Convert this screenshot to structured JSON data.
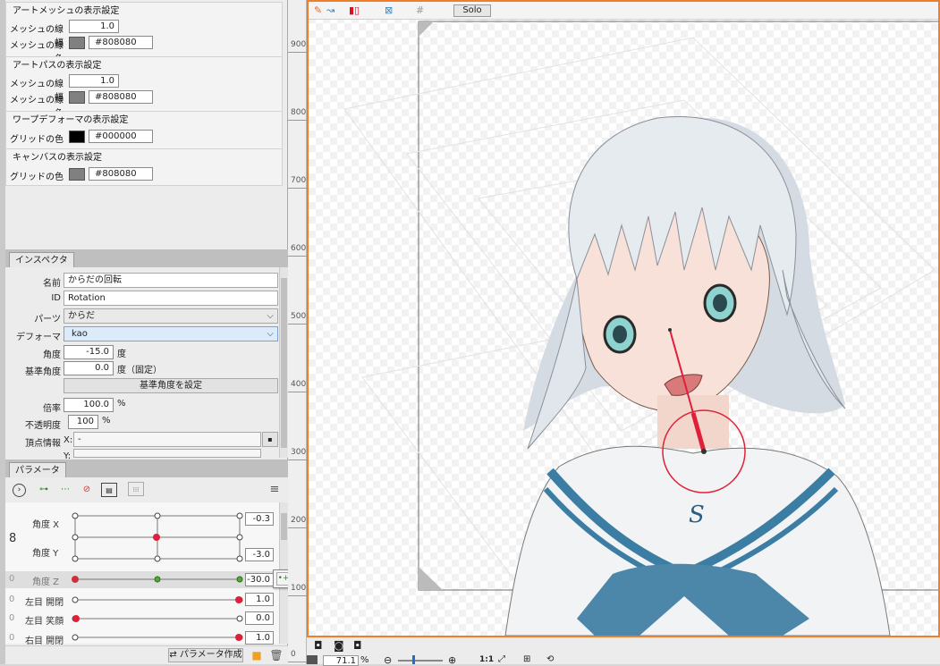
{
  "display_settings": {
    "artmesh_title": "アートメッシュの表示設定",
    "artmesh_line_width_label": "メッシュの線幅",
    "artmesh_line_width_value": "1.0",
    "artmesh_line_color_label": "メッシュの線色",
    "artmesh_line_color": "#808080",
    "artpath_title": "アートパスの表示設定",
    "artpath_line_width_label": "メッシュの線幅",
    "artpath_line_width_value": "1.0",
    "artpath_line_color_label": "メッシュの線色",
    "artpath_line_color": "#808080",
    "warp_title": "ワープデフォーマの表示設定",
    "warp_grid_label": "グリッドの色",
    "warp_grid_color": "#000000",
    "canvas_title": "キャンバスの表示設定",
    "canvas_grid_label": "グリッドの色",
    "canvas_grid_color": "#808080"
  },
  "inspector": {
    "tab": "インスペクタ",
    "name_label": "名前",
    "name_value": "からだの回転",
    "id_label": "ID",
    "id_value": "Rotation",
    "parts_label": "パーツ",
    "parts_value": "からだ",
    "deformer_label": "デフォーマ",
    "deformer_value": "kao",
    "angle_label": "角度",
    "angle_value": "-15.0",
    "angle_unit": "度",
    "base_angle_label": "基準角度",
    "base_angle_value": "0.0",
    "base_angle_unit": "度（固定）",
    "set_base_angle_button": "基準角度を設定",
    "scale_label": "倍率",
    "scale_value": "100.0",
    "scale_unit": "%",
    "opacity_label": "不透明度",
    "opacity_value": "100",
    "opacity_unit": "%",
    "vertex_label": "頂点情報",
    "vertex_x": "X:",
    "vertex_x_value": "-",
    "vertex_y": "Y:"
  },
  "parameters": {
    "tab": "パラメータ",
    "rows": [
      {
        "label": "角度 X",
        "value": "-0.3"
      },
      {
        "label": "角度 Y",
        "value": "-3.0"
      },
      {
        "label": "角度 Z",
        "value": "-30.0"
      },
      {
        "label": "左目 開閉",
        "value": "1.0"
      },
      {
        "label": "左目 笑顔",
        "value": "0.0"
      },
      {
        "label": "右目 開閉",
        "value": "1.0"
      }
    ],
    "create_button": "パラメータ作成",
    "popup_dropdown": "▼"
  },
  "ruler": {
    "ticks": [
      "900",
      "800",
      "700",
      "600",
      "500",
      "400",
      "300",
      "200",
      "100",
      "0"
    ]
  },
  "toolbar": {
    "solo_label": "Solo"
  },
  "statusbar": {
    "zoom_value": "71.1",
    "zoom_unit": "%",
    "ratio_label": "1:1"
  },
  "colors": {
    "accent": "#f07f2c",
    "selection_red": "#e0203a",
    "keyframe_green": "#55a833"
  }
}
